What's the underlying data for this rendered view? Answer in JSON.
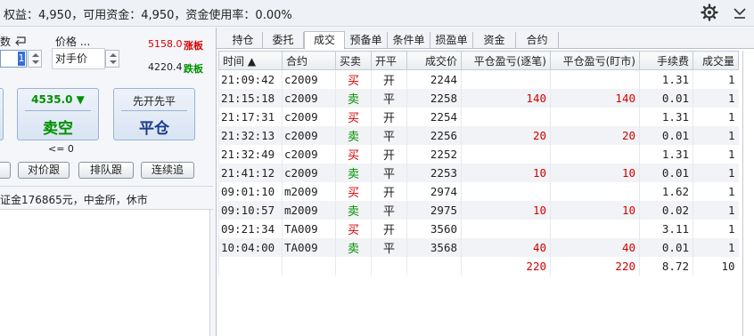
{
  "status_text": "权益：4,950，可用资金：4,950，资金使用率：0.00%",
  "left": {
    "qty_label": "数",
    "qty_value": "1",
    "price_label": "价格 ...",
    "price_mode": "对手价",
    "limit_up_price": "5158.0",
    "limit_up_tag": "涨板",
    "limit_down_price": "4220.4",
    "limit_down_tag": "跌板",
    "sell_price": "4535.0 ▼",
    "sell_action": "卖空",
    "close_top": "先开先平",
    "close_action": "平仓",
    "le_zero": "<= 0",
    "btn_follow_price": "对价跟",
    "btn_queue_follow": "排队跟",
    "btn_continuous": "连续追",
    "info_text": "证金176865元，中金所，休市"
  },
  "tabs": [
    "持仓",
    "委托",
    "成交",
    "预备单",
    "条件单",
    "损盈单",
    "资金",
    "合约"
  ],
  "active_tab": 2,
  "columns": [
    "时间 ▲",
    "合约",
    "买卖",
    "开平",
    "成交价",
    "平仓盈亏(逐笔)",
    "平仓盈亏(盯市)",
    "手续费",
    "成交量"
  ],
  "rows": [
    {
      "time": "21:09:42",
      "code": "c2009",
      "side": "买",
      "oc": "开",
      "price": "2244",
      "pnl1": "",
      "pnl2": "",
      "fee": "1.31",
      "vol": "1"
    },
    {
      "time": "21:15:18",
      "code": "c2009",
      "side": "卖",
      "oc": "平",
      "price": "2258",
      "pnl1": "140",
      "pnl2": "140",
      "fee": "0.01",
      "vol": "1"
    },
    {
      "time": "21:17:31",
      "code": "c2009",
      "side": "买",
      "oc": "开",
      "price": "2254",
      "pnl1": "",
      "pnl2": "",
      "fee": "1.31",
      "vol": "1"
    },
    {
      "time": "21:32:13",
      "code": "c2009",
      "side": "卖",
      "oc": "平",
      "price": "2256",
      "pnl1": "20",
      "pnl2": "20",
      "fee": "0.01",
      "vol": "1"
    },
    {
      "time": "21:32:49",
      "code": "c2009",
      "side": "买",
      "oc": "开",
      "price": "2252",
      "pnl1": "",
      "pnl2": "",
      "fee": "1.31",
      "vol": "1"
    },
    {
      "time": "21:41:12",
      "code": "c2009",
      "side": "卖",
      "oc": "平",
      "price": "2253",
      "pnl1": "10",
      "pnl2": "10",
      "fee": "0.01",
      "vol": "1"
    },
    {
      "time": "09:01:10",
      "code": "m2009",
      "side": "买",
      "oc": "开",
      "price": "2974",
      "pnl1": "",
      "pnl2": "",
      "fee": "1.62",
      "vol": "1"
    },
    {
      "time": "09:10:57",
      "code": "m2009",
      "side": "卖",
      "oc": "平",
      "price": "2975",
      "pnl1": "10",
      "pnl2": "10",
      "fee": "0.02",
      "vol": "1"
    },
    {
      "time": "09:21:34",
      "code": "TA009",
      "side": "买",
      "oc": "开",
      "price": "3560",
      "pnl1": "",
      "pnl2": "",
      "fee": "3.11",
      "vol": "1"
    },
    {
      "time": "10:04:00",
      "code": "TA009",
      "side": "卖",
      "oc": "平",
      "price": "3568",
      "pnl1": "40",
      "pnl2": "40",
      "fee": "0.01",
      "vol": "1"
    }
  ],
  "totals": {
    "pnl1": "220",
    "pnl2": "220",
    "fee": "8.72",
    "vol": "10"
  },
  "colors": {
    "buy": "#d40000",
    "sell": "#009000",
    "accent": "#3470d8"
  }
}
